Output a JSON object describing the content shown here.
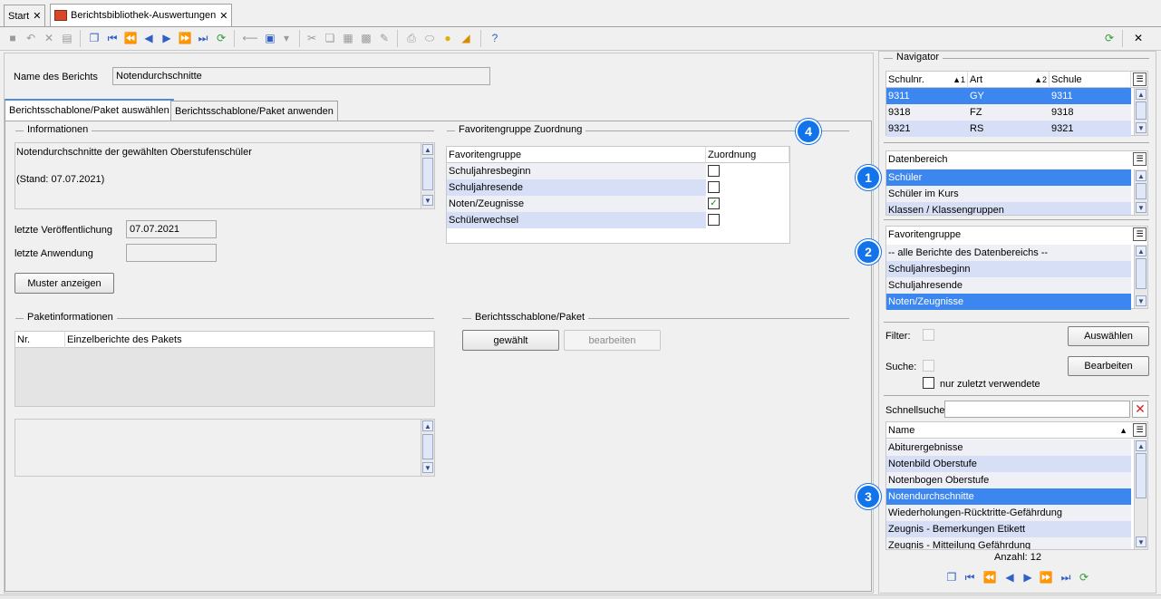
{
  "tabs": [
    {
      "label": "Start",
      "close": "✕"
    },
    {
      "label": "Berichtsbibliothek-Auswertungen",
      "close": "✕"
    }
  ],
  "window_close": "✕",
  "report": {
    "name_label": "Name des Berichts",
    "name_value": "Notendurchschnitte"
  },
  "inner_tabs": [
    "Berichtsschablone/Paket auswählen",
    "Berichtsschablone/Paket anwenden"
  ],
  "info": {
    "title": "Informationen",
    "line1": "Notendurchschnitte der gewählten Oberstufenschüler",
    "line2": "(Stand: 07.07.2021)",
    "last_pub_label": "letzte Veröffentlichung",
    "last_pub_value": "07.07.2021",
    "last_use_label": "letzte Anwendung",
    "last_use_value": "",
    "show_sample_button": "Muster anzeigen"
  },
  "favorites": {
    "title": "Favoritengruppe Zuordnung",
    "col_group": "Favoritengruppe",
    "col_assign": "Zuordnung",
    "rows": [
      {
        "name": "Schuljahresbeginn",
        "checked": false
      },
      {
        "name": "Schuljahresende",
        "checked": false
      },
      {
        "name": "Noten/Zeugnisse",
        "checked": true
      },
      {
        "name": "Schülerwechsel",
        "checked": false
      }
    ]
  },
  "package": {
    "title": "Paketinformationen",
    "col_nr": "Nr.",
    "col_reports": "Einzelberichte des Pakets"
  },
  "template": {
    "title": "Berichtsschablone/Paket",
    "chosen_button": "gewählt",
    "edit_button": "bearbeiten"
  },
  "navigator": {
    "title": "Navigator",
    "school_cols": [
      "Schulnr.",
      "Art",
      "Schule"
    ],
    "school_sort": [
      "▲1",
      "▲2"
    ],
    "schools": [
      [
        "9311",
        "GY",
        "9311"
      ],
      [
        "9318",
        "FZ",
        "9318"
      ],
      [
        "9321",
        "RS",
        "9321"
      ]
    ],
    "data_area_title": "Datenbereich",
    "data_areas": [
      "Schüler",
      "Schüler im Kurs",
      "Klassen / Klassengruppen"
    ],
    "fav_title": "Favoritengruppe",
    "fav_items": [
      "-- alle Berichte des Datenbereichs --",
      "Schuljahresbeginn",
      "Schuljahresende",
      "Noten/Zeugnisse"
    ],
    "filter_label": "Filter:",
    "search_label": "Suche:",
    "select_button": "Auswählen",
    "edit_button": "Bearbeiten",
    "recent_label": "nur zuletzt verwendete",
    "quicksearch_label": "Schnellsuche",
    "name_col": "Name",
    "names": [
      "Abiturergebnisse",
      "Notenbild Oberstufe",
      "Notenbogen Oberstufe",
      "Notendurchschnitte",
      "Wiederholungen-Rücktritte-Gefährdung",
      "Zeugnis - Bemerkungen Etikett",
      "Zeugnis - Mitteilung Gefährdung"
    ],
    "count_label": "Anzahl: 12"
  },
  "badges": [
    "1",
    "2",
    "3",
    "4"
  ]
}
